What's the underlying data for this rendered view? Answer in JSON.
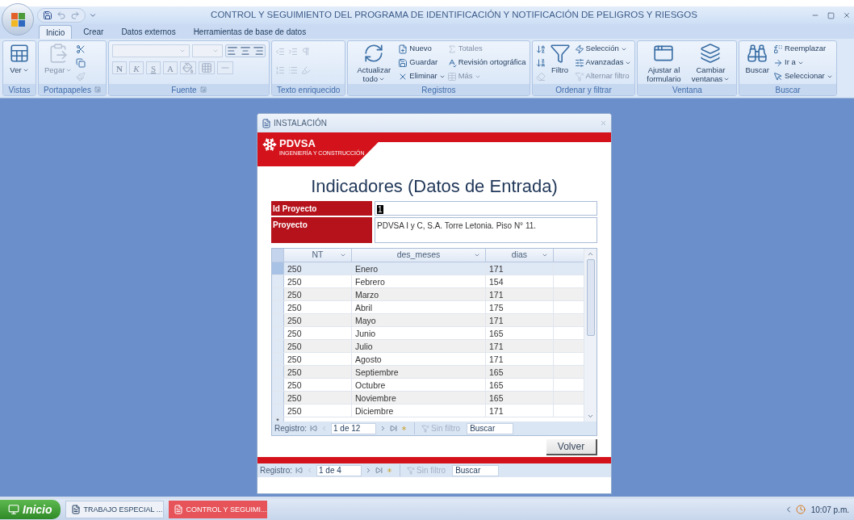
{
  "window": {
    "title": "CONTROL Y SEGUIMIENTO DEL PROGRAMA DE IDENTIFICACIÓN Y NOTIFICACIÓN DE PELIGROS Y RIESGOS"
  },
  "ribbon": {
    "tabs": [
      {
        "label": "Inicio",
        "selected": true
      },
      {
        "label": "Crear",
        "selected": false
      },
      {
        "label": "Datos externos",
        "selected": false
      },
      {
        "label": "Herramientas de base de datos",
        "selected": false
      }
    ],
    "groups": [
      {
        "label": "Vistas",
        "kind": "buttons",
        "launcher": false,
        "items": [
          {
            "kind": "large",
            "label": "Ver",
            "disabled": false,
            "dropdown": true
          }
        ]
      },
      {
        "label": "Portapapeles",
        "kind": "buttons",
        "launcher": true,
        "items": [
          {
            "kind": "large",
            "label": "Pegar",
            "disabled": true,
            "dropdown": true
          },
          {
            "kind": "icon",
            "disabled": false
          },
          {
            "kind": "icon",
            "disabled": false
          },
          {
            "kind": "icon",
            "disabled": true
          }
        ]
      },
      {
        "label": "Fuente",
        "kind": "font",
        "launcher": true,
        "format_buttons": [
          "N",
          "K",
          "S",
          "A"
        ]
      },
      {
        "label": "Texto enriquecido",
        "kind": "toolbar",
        "launcher": false,
        "items": [
          {
            "kind": "icon",
            "disabled": true
          },
          {
            "kind": "icon",
            "disabled": true
          },
          {
            "kind": "icon",
            "disabled": true
          },
          {
            "kind": "icon",
            "disabled": true
          },
          {
            "kind": "icon",
            "disabled": true
          },
          {
            "kind": "icon",
            "disabled": true
          }
        ]
      },
      {
        "label": "Registros",
        "kind": "buttons",
        "launcher": false,
        "items": [
          {
            "kind": "large",
            "label": "Actualizar todo",
            "disabled": false,
            "dropdown": true
          },
          {
            "kind": "small",
            "label": "Nuevo",
            "disabled": false,
            "dropdown": false
          },
          {
            "kind": "small",
            "label": "Guardar",
            "disabled": false,
            "dropdown": false
          },
          {
            "kind": "small",
            "label": "Eliminar",
            "disabled": false,
            "dropdown": true
          },
          {
            "kind": "small",
            "label": "Totales",
            "disabled": true,
            "dropdown": false
          },
          {
            "kind": "small",
            "label": "Revisión ortográfica",
            "disabled": false,
            "dropdown": false
          },
          {
            "kind": "small",
            "label": "Más",
            "disabled": true,
            "dropdown": true
          }
        ]
      },
      {
        "label": "Ordenar y filtrar",
        "kind": "buttons",
        "launcher": false,
        "items": [
          {
            "kind": "icon",
            "disabled": false
          },
          {
            "kind": "icon",
            "disabled": false
          },
          {
            "kind": "icon",
            "disabled": true
          },
          {
            "kind": "large",
            "label": "Filtro",
            "disabled": false,
            "dropdown": false
          },
          {
            "kind": "small",
            "label": "Selección",
            "disabled": false,
            "dropdown": true
          },
          {
            "kind": "small",
            "label": "Avanzadas",
            "disabled": false,
            "dropdown": true
          },
          {
            "kind": "small",
            "label": "Alternar filtro",
            "disabled": true,
            "dropdown": false
          }
        ]
      },
      {
        "label": "Ventana",
        "kind": "buttons",
        "launcher": false,
        "items": [
          {
            "kind": "large",
            "label": "Ajustar al formulario",
            "disabled": false,
            "dropdown": false
          },
          {
            "kind": "large",
            "label": "Cambiar ventanas",
            "disabled": false,
            "dropdown": true
          }
        ]
      },
      {
        "label": "Buscar",
        "kind": "buttons",
        "launcher": false,
        "items": [
          {
            "kind": "large",
            "label": "Buscar",
            "disabled": false,
            "dropdown": false
          },
          {
            "kind": "small",
            "label": "Reemplazar",
            "disabled": false,
            "dropdown": false
          },
          {
            "kind": "small",
            "label": "Ir a",
            "disabled": false,
            "dropdown": true
          },
          {
            "kind": "small",
            "label": "Seleccionar",
            "disabled": false,
            "dropdown": true
          }
        ]
      }
    ]
  },
  "form": {
    "title": "INSTALACIÓN",
    "logo": {
      "name": "PDVSA",
      "tagline": "INGENIERÍA Y CONSTRUCCIÓN"
    },
    "heading": "Indicadores (Datos de Entrada)",
    "fields": [
      {
        "label": "Id Proyecto",
        "value": "1"
      },
      {
        "label": "Proyecto",
        "value": "PDVSA I y C, S.A. Torre Letonia. Piso N° 11."
      }
    ],
    "table": {
      "columns": [
        "NT",
        "des_meses",
        "dias"
      ],
      "new_row_marker": "*",
      "rows": [
        {
          "cells": [
            "250",
            "Enero",
            "171"
          ],
          "selected": true
        },
        {
          "cells": [
            "250",
            "Febrero",
            "154"
          ],
          "selected": false
        },
        {
          "cells": [
            "250",
            "Marzo",
            "171"
          ],
          "selected": false
        },
        {
          "cells": [
            "250",
            "Abril",
            "175"
          ],
          "selected": false
        },
        {
          "cells": [
            "250",
            "Mayo",
            "171"
          ],
          "selected": false
        },
        {
          "cells": [
            "250",
            "Junio",
            "165"
          ],
          "selected": false
        },
        {
          "cells": [
            "250",
            "Julio",
            "171"
          ],
          "selected": false
        },
        {
          "cells": [
            "250",
            "Agosto",
            "171"
          ],
          "selected": false
        },
        {
          "cells": [
            "250",
            "Septiembre",
            "165"
          ],
          "selected": false
        },
        {
          "cells": [
            "250",
            "Octubre",
            "165"
          ],
          "selected": false
        },
        {
          "cells": [
            "250",
            "Noviembre",
            "165"
          ],
          "selected": false
        },
        {
          "cells": [
            "250",
            "Diciembre",
            "171"
          ],
          "selected": false
        }
      ],
      "nav": {
        "label": "Registro:",
        "position": "1 de 12",
        "filter": "Sin filtro",
        "search_placeholder": "Buscar"
      }
    },
    "button": "Volver",
    "nav": {
      "label": "Registro:",
      "position": "1 de 4",
      "filter": "Sin filtro",
      "search_placeholder": "Buscar"
    }
  },
  "taskbar": {
    "start": "Inicio",
    "tasks": [
      {
        "label": "TRABAJO ESPECIAL ...",
        "selected": false
      },
      {
        "label": "CONTROL Y SEGUIMI...",
        "selected": true
      }
    ],
    "clock": "10:07 p.m."
  }
}
